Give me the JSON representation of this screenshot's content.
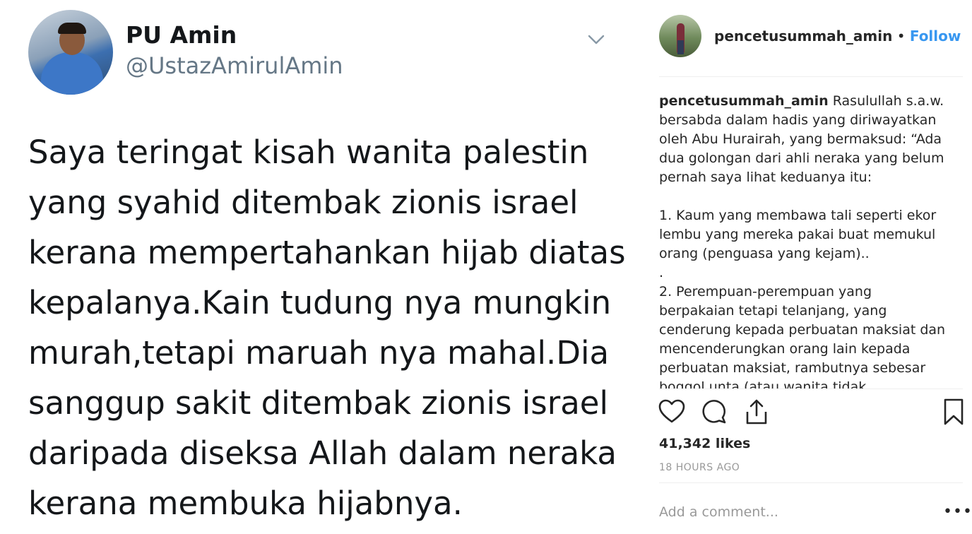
{
  "tweet": {
    "name": "PU Amin",
    "handle": "@UstazAmirulAmin",
    "text": "Saya teringat kisah wanita palestin yang syahid ditembak zionis israel kerana mempertahankan hijab diatas kepalanya.Kain tudung nya mungkin murah,tetapi maruah nya mahal.Dia sanggup sakit ditembak zionis israel daripada diseksa Allah dalam neraka kerana membuka hijabnya."
  },
  "instagram": {
    "username": "pencetusummah_amin",
    "separator": "•",
    "follow_label": "Follow",
    "caption_user": "pencetusummah_amin",
    "caption_text": " Rasulullah s.a.w. bersabda dalam hadis yang diriwayatkan oleh Abu Hurairah, yang bermaksud: “Ada dua golongan dari ahli neraka yang belum pernah saya lihat keduanya itu:\n\n1. Kaum yang membawa tali seperti ekor lembu yang mereka pakai buat memukul orang (penguasa yang kejam)..\n.\n2. Perempuan-perempuan yang berpakaian tetapi telanjang, yang cenderung kepada perbuatan maksiat dan mencenderungkan orang lain kepada perbuatan maksiat, rambutnya sebesar boggol unta (atau wanita tidak bertudung.). Mereka ini tidak",
    "likes": "41,342 likes",
    "time": "18 HOURS AGO",
    "comment_placeholder": "Add a comment...",
    "more_label": "•••",
    "icons": [
      "heart-icon",
      "comment-icon",
      "share-icon",
      "bookmark-icon"
    ],
    "colors": {
      "follow": "#3897f0",
      "muted": "#999999"
    }
  }
}
